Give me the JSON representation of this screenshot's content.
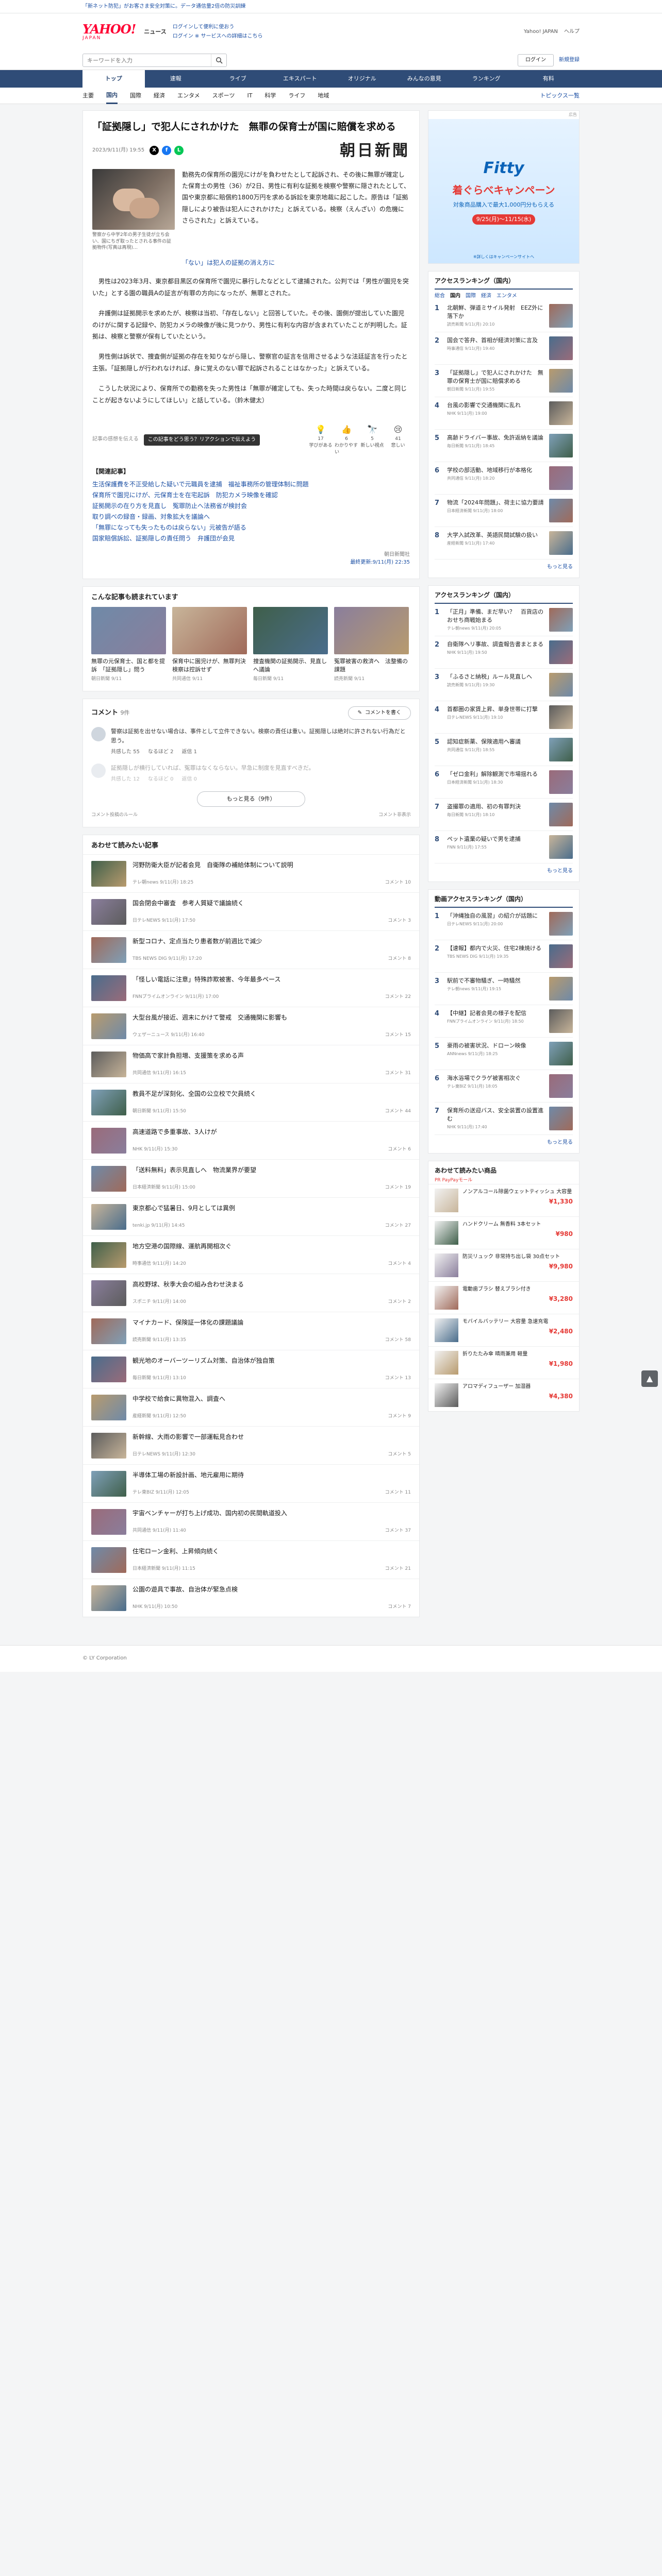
{
  "topbar": {
    "promo": "「新ネット防犯」がお客さま安全対策に。データ通信量2倍の防災訓練",
    "links": [
      "Yahoo! JAPAN",
      "ヘルプ"
    ]
  },
  "header": {
    "logo": "YAHOO!",
    "logo_sub": "JAPAN",
    "logo_news": "ニュース",
    "promo_lines": [
      "ログインして便利に使おう",
      "ログイン ※ サービスへの詳細はこちら"
    ],
    "right_links": [
      "Yahoo! JAPAN",
      "ヘルプ"
    ]
  },
  "search": {
    "placeholder": "キーワードを入力",
    "login_label": "ログイン",
    "signup_label": "新規登録"
  },
  "gnav": [
    "トップ",
    "速報",
    "ライブ",
    "エキスパート",
    "オリジナル",
    "みんなの意見",
    "ランキング",
    "有料"
  ],
  "gnav_active": 0,
  "subnav": [
    "主要",
    "国内",
    "国際",
    "経済",
    "エンタメ",
    "スポーツ",
    "IT",
    "科学",
    "ライフ",
    "地域"
  ],
  "subnav_active": 1,
  "subnav_more": "トピックス一覧",
  "article": {
    "title": "「証拠隠し」で犯人にされかけた　無罪の保育士が国に賠償を求める",
    "date": "2023/9/11(月) 19:55",
    "publisher": "朝日新聞",
    "photo_caption": "警察から中学2年の男子生徒が立ち会い、国にちぎ取ったとされる事件の証拠物件(写真は再現)…",
    "lead": "勤務先の保育所の園児にけがを負わせたとして起訴され、その後に無罪が確定した保育士の男性（36）が2日、男性に有利な証拠を検察や警察に隠されたとして、国や東京都に賠償約1800万円を求める訴訟を東京地裁に起こした。原告は「証拠隠しにより被告は犯人にされかけた」と訴えている。検察（えんざい）の危機にさらされた」と訴えている。",
    "photo_link": "「ない」は犯人の証拠の消え方に",
    "paragraphs": [
      "男性は2023年3月、東京都目黒区の保育所で園児に暴行したなどとして逮捕された。公判では「男性が園児を突いた」とする園の職員Aの証言が有罪の方向になったが、無罪とされた。",
      "弁護側は証拠開示を求めたが、検察は当初、「存在しない」と回答していた。その後、園側が提出していた園児のけがに関する記録や、防犯カメラの映像が後に見つかり、男性に有利な内容が含まれていたことが判明した。証拠は、検察と警察が保有していたという。",
      "男性側は訴状で、捜査側が証拠の存在を知りながら隠し、警察官の証言を信用させるような法廷証言を行ったと主張。「証拠隠しが行われなければ、身に覚えのない罪で起訴されることはなかった」と訴えている。",
      "こうした状況により、保育所での勤務を失った男性は「無罪が確定しても、失った時間は戻らない。二度と同じことが起きないようにしてほしい」と話している。（鈴木健太）"
    ],
    "tooltip": "この記事をどう思う？リアクションで伝えよう",
    "note_label": "記事の感想を伝える",
    "reactions": [
      {
        "label": "学びがある",
        "icon": "💡",
        "count": "17"
      },
      {
        "label": "わかりやすい",
        "icon": "👍",
        "count": "6"
      },
      {
        "label": "新しい視点",
        "icon": "🔭",
        "count": "5"
      },
      {
        "label": "悲しい",
        "icon": "😢",
        "count": "41"
      }
    ],
    "related_title": "【関連記事】",
    "related": [
      "生活保護費を不正受給した疑いで元職員を逮捕　福祉事務所の管理体制に問題",
      "保育所で園児にけが、元保育士を在宅起訴　防犯カメラ映像を確認",
      "証拠開示の在り方を見直し　冤罪防止へ法務省が検討会",
      "取り調べの録音・録画、対象拡大を議論へ",
      "「無罪になっても失ったものは戻らない」元被告が語る",
      "国家賠償訴訟、証拠隠しの責任問う　弁護団が会見"
    ],
    "credit": "朝日新聞社",
    "credit_link": "最終更新:9/11(月) 22:35"
  },
  "similar": {
    "heading": "こんな記事も読まれています",
    "items": [
      {
        "title": "無罪の元保育士、国と都を提訴　「証拠隠し」問う",
        "src": "朝日新聞 9/11"
      },
      {
        "title": "保育中に園児けが、無罪判決　検察は控訴せず",
        "src": "共同通信 9/11"
      },
      {
        "title": "捜査機関の証拠開示、見直しへ議論",
        "src": "毎日新聞 9/11"
      },
      {
        "title": "冤罪被害の救済へ　法整備の課題",
        "src": "読売新聞 9/11"
      }
    ]
  },
  "comments": {
    "title": "コメント",
    "count": "9件",
    "write": "コメントを書く",
    "items": [
      {
        "text": "警察は証拠を出せない場合は、事件として立件できない。検察の責任は重い。証拠隠しは絶対に許されない行為だと思う。",
        "likes": "共感した 55",
        "think": "なるほど 2",
        "reply": "返信 1"
      },
      {
        "text": "証拠隠しが横行していれば、冤罪はなくならない。早急に制度を見直すべきだ。",
        "likes": "共感した 12",
        "think": "なるほど 0",
        "reply": "返信 0"
      }
    ],
    "more": "もっと見る（9件）",
    "foot_left": "コメント投稿のルール",
    "foot_right": "コメント非表示"
  },
  "feed": {
    "heading": "あわせて読みたい記事",
    "items": [
      {
        "title": "河野防衛大臣が記者会見　自衛隊の補給体制について説明",
        "src": "テレ朝news 9/11(月) 18:25",
        "comm": "コメント 10"
      },
      {
        "title": "国会閉会中審査　参考人質疑で議論続く",
        "src": "日テレNEWS 9/11(月) 17:50",
        "comm": "コメント 3"
      },
      {
        "title": "新型コロナ、定点当たり患者数が前週比で減少",
        "src": "TBS NEWS DIG 9/11(月) 17:20",
        "comm": "コメント 8"
      },
      {
        "title": "「怪しい電話に注意」特殊詐欺被害、今年最多ペース",
        "src": "FNNプライムオンライン 9/11(月) 17:00",
        "comm": "コメント 22"
      },
      {
        "title": "大型台風が接近、週末にかけて警戒　交通機関に影響も",
        "src": "ウェザーニュース 9/11(月) 16:40",
        "comm": "コメント 15"
      },
      {
        "title": "物価高で家計負担増、支援策を求める声",
        "src": "共同通信 9/11(月) 16:15",
        "comm": "コメント 31"
      },
      {
        "title": "教員不足が深刻化、全国の公立校で欠員続く",
        "src": "朝日新聞 9/11(月) 15:50",
        "comm": "コメント 44"
      },
      {
        "title": "高速道路で多重事故、3人けが",
        "src": "NHK 9/11(月) 15:30",
        "comm": "コメント 6"
      },
      {
        "title": "「送料無料」表示見直しへ　物流業界が要望",
        "src": "日本経済新聞 9/11(月) 15:00",
        "comm": "コメント 19"
      },
      {
        "title": "東京都心で猛暑日、9月としては異例",
        "src": "tenki.jp 9/11(月) 14:45",
        "comm": "コメント 27"
      },
      {
        "title": "地方空港の国際線、運航再開相次ぐ",
        "src": "時事通信 9/11(月) 14:20",
        "comm": "コメント 4"
      },
      {
        "title": "高校野球、秋季大会の組み合わせ決まる",
        "src": "スポニチ 9/11(月) 14:00",
        "comm": "コメント 2"
      },
      {
        "title": "マイナカード、保険証一体化の課題議論",
        "src": "読売新聞 9/11(月) 13:35",
        "comm": "コメント 58"
      },
      {
        "title": "観光地のオーバーツーリズム対策、自治体が独自策",
        "src": "毎日新聞 9/11(月) 13:10",
        "comm": "コメント 13"
      },
      {
        "title": "中学校で給食に異物混入、調査へ",
        "src": "産経新聞 9/11(月) 12:50",
        "comm": "コメント 9"
      },
      {
        "title": "新幹線、大雨の影響で一部運転見合わせ",
        "src": "日テレNEWS 9/11(月) 12:30",
        "comm": "コメント 5"
      },
      {
        "title": "半導体工場の新設計画、地元雇用に期待",
        "src": "テレ東BIZ 9/11(月) 12:05",
        "comm": "コメント 11"
      },
      {
        "title": "宇宙ベンチャーが打ち上げ成功、国内初の民間軌道投入",
        "src": "共同通信 9/11(月) 11:40",
        "comm": "コメント 37"
      },
      {
        "title": "住宅ローン金利、上昇傾向続く",
        "src": "日本経済新聞 9/11(月) 11:15",
        "comm": "コメント 21"
      },
      {
        "title": "公園の遊具で事故、自治体が緊急点検",
        "src": "NHK 9/11(月) 10:50",
        "comm": "コメント 7"
      }
    ]
  },
  "side": {
    "ad": {
      "top": "Fitty",
      "mid": "着ぐらべキャンペーン",
      "sub": "対象商品購入で最大1,000円分もらえる",
      "date": "9/25(月)〜11/15(水)",
      "note": "※詳しくはキャンペーンサイトへ",
      "label": "広告"
    },
    "rank1": {
      "heading": "アクセスランキング（国内）",
      "tabs": [
        "総合",
        "国内",
        "国際",
        "経済",
        "エンタメ"
      ],
      "active_tab": 1,
      "items": [
        {
          "title": "北朝鮮、弾道ミサイル発射　EEZ外に落下か",
          "src": "読売新聞 9/11(月) 20:10"
        },
        {
          "title": "国会で答弁、首相が経済対策に言及",
          "src": "時事通信 9/11(月) 19:40"
        },
        {
          "title": "「証拠隠し」で犯人にされかけた　無罪の保育士が国に賠償求める",
          "src": "朝日新聞 9/11(月) 19:55"
        },
        {
          "title": "台風の影響で交通機関に乱れ",
          "src": "NHK 9/11(月) 19:00"
        },
        {
          "title": "高齢ドライバー事故、免許返納を議論",
          "src": "毎日新聞 9/11(月) 18:45"
        },
        {
          "title": "学校の部活動、地域移行が本格化",
          "src": "共同通信 9/11(月) 18:20"
        },
        {
          "title": "物流「2024年問題」、荷主に協力要請",
          "src": "日本経済新聞 9/11(月) 18:00"
        },
        {
          "title": "大学入試改革、英語民間試験の扱い",
          "src": "産経新聞 9/11(月) 17:40"
        }
      ],
      "more": "もっと見る"
    },
    "rank2": {
      "heading": "アクセスランキング（国内）",
      "items": [
        {
          "title": "「正月」準備、まだ早い？　百貨店のおせち商戦始まる",
          "src": "テレ朝news 9/11(月) 20:05"
        },
        {
          "title": "自衛隊ヘリ事故、調査報告書まとまる",
          "src": "NHK 9/11(月) 19:50"
        },
        {
          "title": "「ふるさと納税」ルール見直しへ",
          "src": "読売新聞 9/11(月) 19:30"
        },
        {
          "title": "首都圏の家賃上昇、単身世帯に打撃",
          "src": "日テレNEWS 9/11(月) 19:10"
        },
        {
          "title": "認知症新薬、保険適用へ審議",
          "src": "共同通信 9/11(月) 18:55"
        },
        {
          "title": "「ゼロ金利」解除観測で市場揺れる",
          "src": "日本経済新聞 9/11(月) 18:30"
        },
        {
          "title": "盗撮罪の適用、初の有罪判決",
          "src": "毎日新聞 9/11(月) 18:10"
        },
        {
          "title": "ペット遺棄の疑いで男を逮捕",
          "src": "FNN 9/11(月) 17:55"
        }
      ],
      "more": "もっと見る"
    },
    "rank3": {
      "heading": "動画アクセスランキング（国内）",
      "items": [
        {
          "title": "「沖縄独自の風習」の紹介が話題に",
          "src": "日テレNEWS 9/11(月) 20:00"
        },
        {
          "title": "【速報】都内で火災、住宅2棟焼ける",
          "src": "TBS NEWS DIG 9/11(月) 19:35"
        },
        {
          "title": "駅前で不審物騒ぎ、一時騒然",
          "src": "テレ朝news 9/11(月) 19:15"
        },
        {
          "title": "【中継】記者会見の様子を配信",
          "src": "FNNプライムオンライン 9/11(月) 18:50"
        },
        {
          "title": "豪雨の被害状況、ドローン映像",
          "src": "ANNnews 9/11(月) 18:25"
        },
        {
          "title": "海水浴場でクラゲ被害相次ぐ",
          "src": "テレ東BIZ 9/11(月) 18:05"
        },
        {
          "title": "保育所の送迎バス、安全装置の設置進む",
          "src": "NHK 9/11(月) 17:40"
        }
      ],
      "more": "もっと見る"
    },
    "shop": {
      "heading": "あわせて読みたい商品",
      "tag": "PR PayPayモール",
      "items": [
        {
          "title": "ノンアルコール除菌ウェットティッシュ 大容量",
          "price": "¥1,330"
        },
        {
          "title": "ハンドクリーム 無香料 3本セット",
          "price": "¥980"
        },
        {
          "title": "防災リュック 非常持ち出し袋 30点セット",
          "price": "¥9,980"
        },
        {
          "title": "電動歯ブラシ 替えブラシ付き",
          "price": "¥3,280"
        },
        {
          "title": "モバイルバッテリー 大容量 急速充電",
          "price": "¥2,480"
        },
        {
          "title": "折りたたみ傘 晴雨兼用 軽量",
          "price": "¥1,980"
        },
        {
          "title": "アロマディフューザー 加湿器",
          "price": "¥4,380"
        }
      ]
    }
  },
  "footer": "© LY Corporation"
}
